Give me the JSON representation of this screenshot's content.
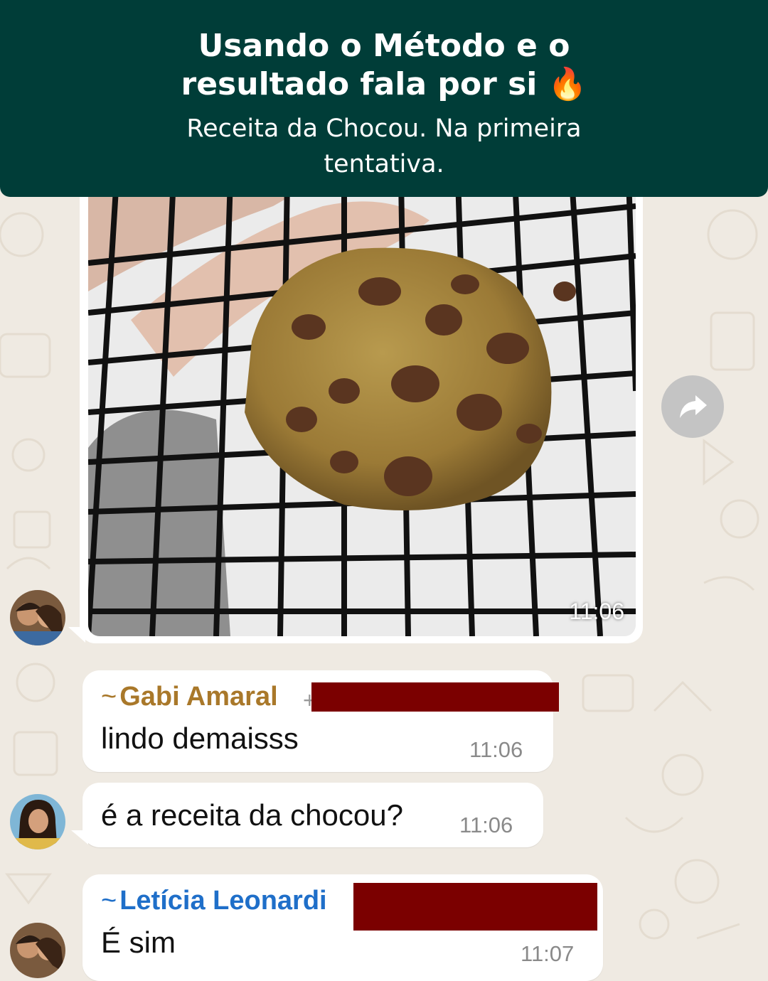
{
  "banner": {
    "title": "Usando o Método e o resultado fala por si 🔥",
    "subtitle": "Receita da Chocou. Na primeira tentativa."
  },
  "chat": {
    "image_message": {
      "time": "11:06"
    },
    "messages": [
      {
        "sender": "Gabi Amaral",
        "sender_prefix": "~",
        "text": "lindo demaisss",
        "time": "11:06",
        "sender_color": "#a9782a"
      },
      {
        "text": "é a receita da chocou?",
        "time": "11:06"
      },
      {
        "sender": "Letícia Leonardi",
        "sender_prefix": "~",
        "text": "É sim",
        "time": "11:07",
        "sender_color": "#1f6fc9"
      }
    ],
    "phone_prefix": "+"
  },
  "icons": {
    "forward": "forward-arrow-icon",
    "fire": "fire-emoji"
  },
  "colors": {
    "banner_bg": "#003d38",
    "chat_bg": "#efeae2",
    "redaction": "#7b0000"
  }
}
